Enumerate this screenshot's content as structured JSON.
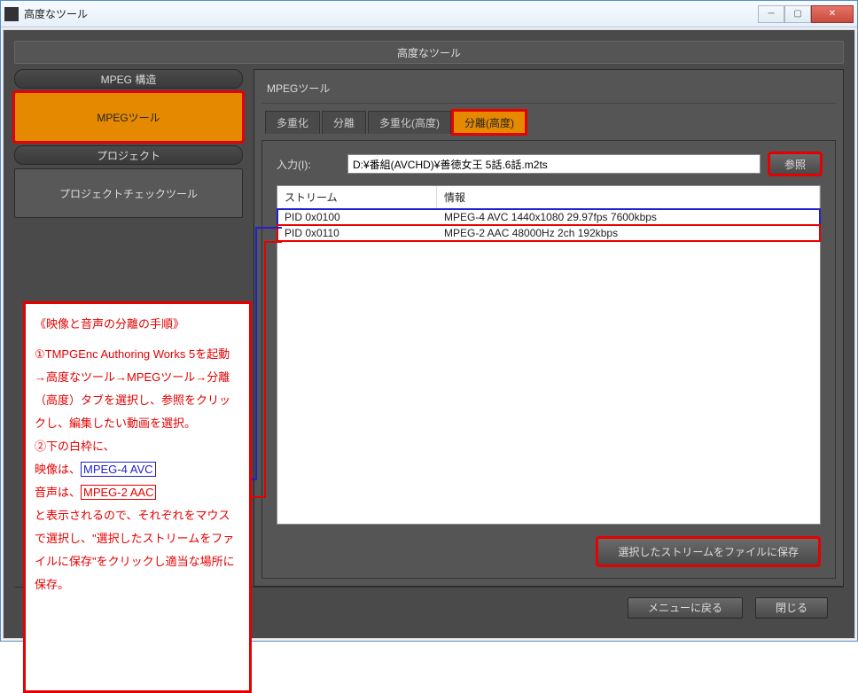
{
  "window": {
    "title": "高度なツール"
  },
  "pageHeader": "高度なツール",
  "sidebar": {
    "section1": "MPEG 構造",
    "btnMpegTool": "MPEGツール",
    "section2": "プロジェクト",
    "btnProjectCheck": "プロジェクトチェックツール"
  },
  "panel": {
    "title": "MPEGツール",
    "tabs": [
      "多重化",
      "分離",
      "多重化(高度)",
      "分離(高度)"
    ],
    "input": {
      "label": "入力(I):",
      "value": "D:¥番組(AVCHD)¥善徳女王 5話.6話.m2ts",
      "browse": "参照"
    },
    "streamTable": {
      "cols": [
        "ストリーム",
        "情報"
      ],
      "rows": [
        {
          "stream": "PID 0x0100",
          "info": "MPEG-4 AVC 1440x1080 29.97fps 7600kbps"
        },
        {
          "stream": "PID 0x0110",
          "info": "MPEG-2 AAC 48000Hz 2ch 192kbps"
        }
      ]
    },
    "save": "選択したストリームをファイルに保存"
  },
  "footer": {
    "back": "メニューに戻る",
    "close": "閉じる"
  },
  "instructions": {
    "title": "《映像と音声の分離の手順》",
    "step1": "①TMPGEnc Authoring Works 5を起動→高度なツール→MPEGツール→分離（高度）タブを選択し、参照をクリックし、編集したい動画を選択。",
    "step2": "②下の白枠に、",
    "video_label": "映像は、",
    "video_codec": "MPEG-4 AVC",
    "audio_label": "音声は、",
    "audio_codec": "MPEG-2 AAC",
    "step3": "と表示されるので、それぞれをマウスで選択し、\"選択したストリームをファイルに保存\"をクリックし適当な場所に保存。"
  }
}
